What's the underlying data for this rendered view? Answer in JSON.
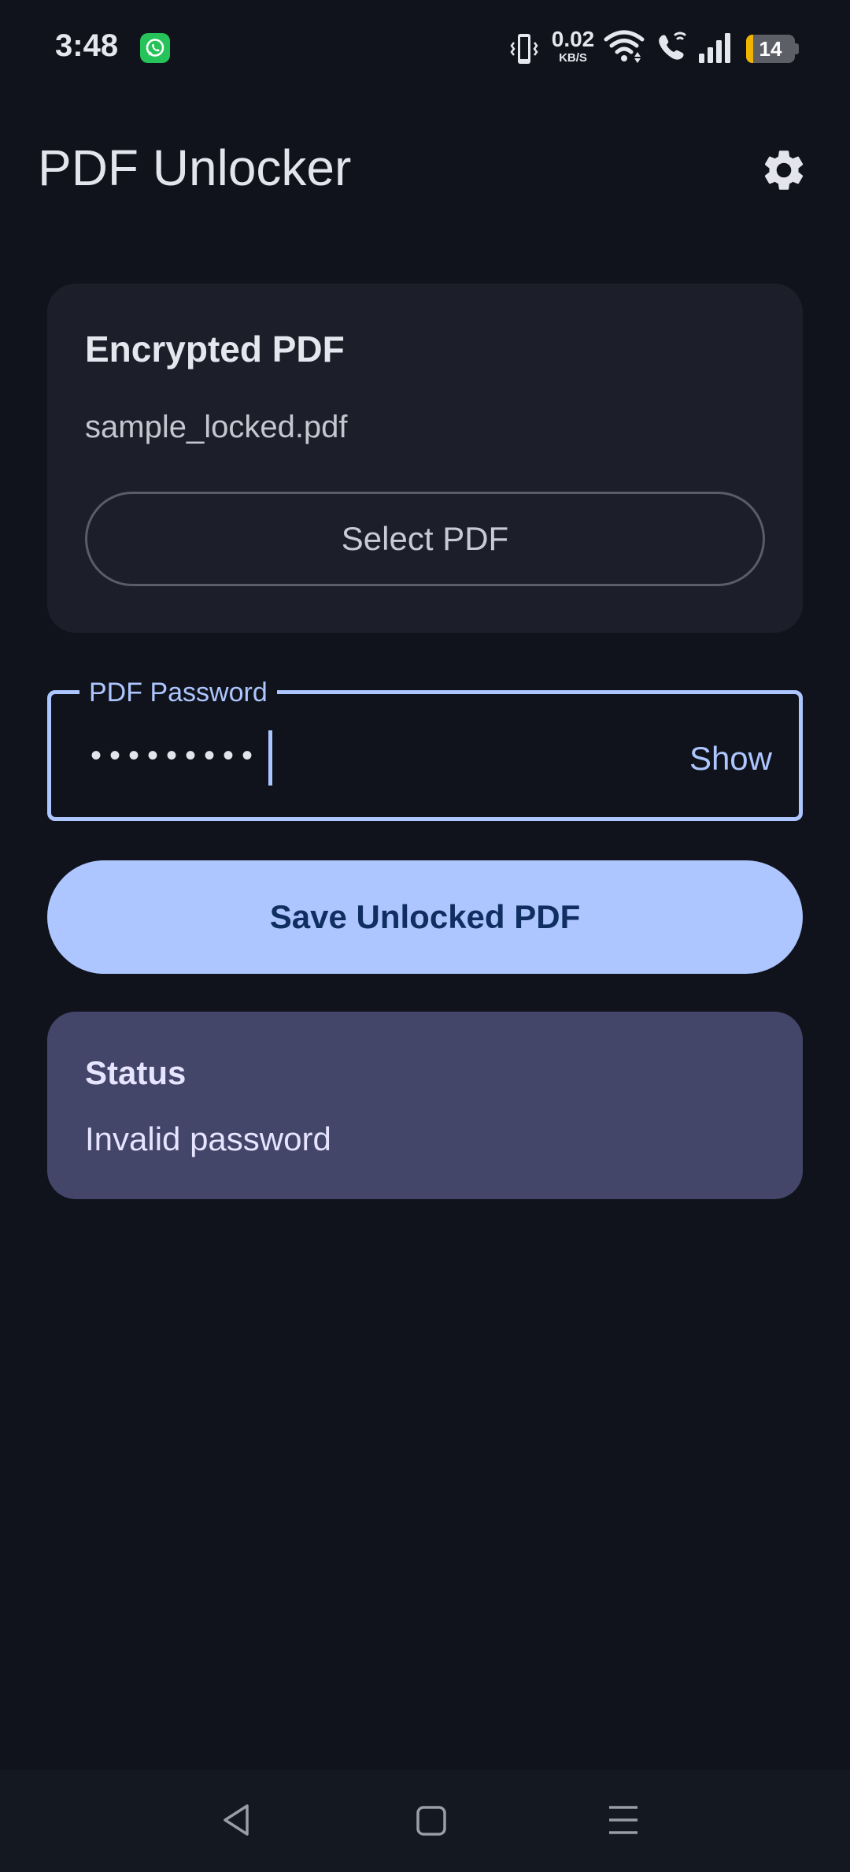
{
  "status_bar": {
    "time": "3:48",
    "net_speed_value": "0.02",
    "net_speed_unit": "KB/S",
    "battery_level": "14",
    "battery_fraction": 0.14,
    "icons": [
      "whatsapp-icon",
      "vibrate-icon",
      "wifi-icon",
      "wifi-call-icon",
      "signal-icon",
      "battery-icon"
    ]
  },
  "app_bar": {
    "title": "PDF Unlocker",
    "settings_icon": "gear-icon"
  },
  "file_card": {
    "title": "Encrypted PDF",
    "file_name": "sample_locked.pdf",
    "select_button": "Select PDF"
  },
  "password_field": {
    "label": "PDF Password",
    "masked_value": "•••••••••",
    "toggle_label": "Show"
  },
  "save_button": "Save Unlocked PDF",
  "status_card": {
    "title": "Status",
    "message": "Invalid password"
  },
  "nav_bar": {
    "icons": [
      "back-icon",
      "home-icon",
      "recents-icon"
    ]
  },
  "colors": {
    "background": "#10131b",
    "card": "#1c1f2a",
    "accent": "#adc6ff",
    "accent_text": "#102f60",
    "status_card": "#434569"
  }
}
